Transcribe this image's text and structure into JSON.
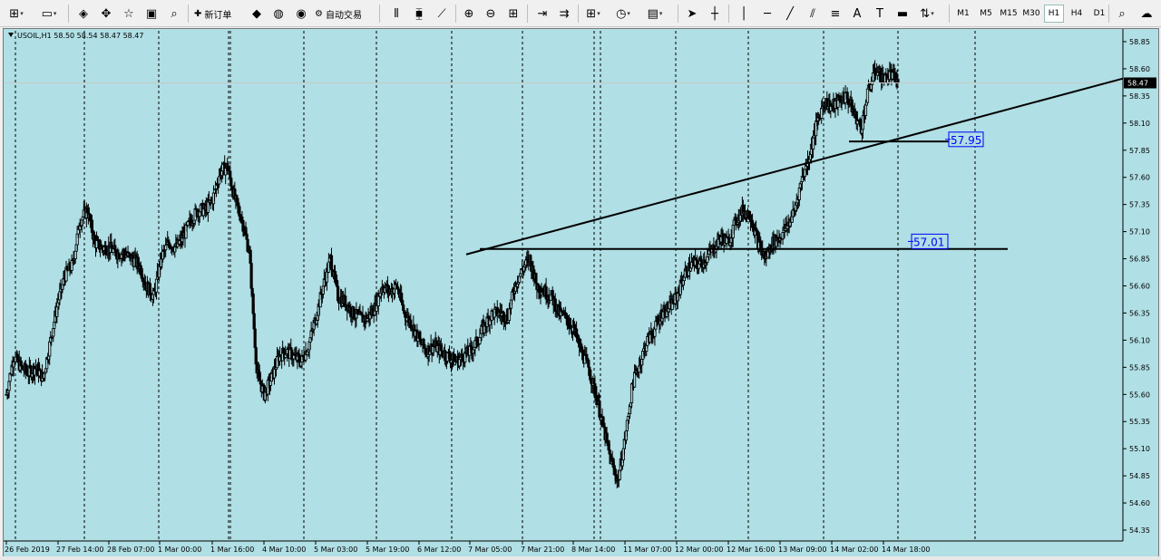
{
  "toolbar": {
    "new_order_label": "新订单",
    "auto_trading_label": "自动交易",
    "timeframes": [
      "M1",
      "M5",
      "M15",
      "M30",
      "H1",
      "H4",
      "D1"
    ],
    "active_timeframe": "H1"
  },
  "chart_data": {
    "type": "candlestick",
    "title": "USOIL,H1  58.50 58.54 58.47 58.47",
    "symbol_timeframe": "USOIL,H1",
    "ohlc": {
      "open": 58.5,
      "high": 58.54,
      "low": 58.47,
      "close": 58.47
    },
    "current_price": "58.47",
    "background_color": "#b0dfe5",
    "ylim": [
      54.25,
      58.95
    ],
    "y_ticks": [
      "58.85",
      "58.60",
      "58.35",
      "58.10",
      "57.85",
      "57.60",
      "57.35",
      "57.10",
      "56.85",
      "56.60",
      "56.35",
      "56.10",
      "55.85",
      "55.60",
      "55.35",
      "55.10",
      "54.85",
      "54.60",
      "54.35"
    ],
    "x_ticks": [
      "26 Feb 2019",
      "27 Feb 14:00",
      "28 Feb 07:00",
      "1 Mar 00:00",
      "1 Mar 16:00",
      "4 Mar 10:00",
      "5 Mar 03:00",
      "5 Mar 19:00",
      "6 Mar 12:00",
      "7 Mar 05:00",
      "7 Mar 21:00",
      "8 Mar 14:00",
      "11 Mar 07:00",
      "12 Mar 00:00",
      "12 Mar 16:00",
      "13 Mar 09:00",
      "14 Mar 02:00",
      "14 Mar 18:00"
    ],
    "grid": "vertical dashed at day separators",
    "closes": [
      55.6,
      55.95,
      55.85,
      55.8,
      55.85,
      55.75,
      56.1,
      56.45,
      56.7,
      56.8,
      57.2,
      57.3,
      57.0,
      56.95,
      56.95,
      56.9,
      56.9,
      56.85,
      56.8,
      56.6,
      56.5,
      56.85,
      57.0,
      56.95,
      57.05,
      57.2,
      57.3,
      57.3,
      57.4,
      57.65,
      57.7,
      57.4,
      57.2,
      56.9,
      55.8,
      55.6,
      55.75,
      55.95,
      56.0,
      55.95,
      55.9,
      56.05,
      56.3,
      56.6,
      56.85,
      56.5,
      56.45,
      56.35,
      56.3,
      56.3,
      56.4,
      56.6,
      56.55,
      56.6,
      56.35,
      56.25,
      56.1,
      56.0,
      56.05,
      56.0,
      55.95,
      55.9,
      55.95,
      56.0,
      56.1,
      56.25,
      56.35,
      56.35,
      56.3,
      56.6,
      56.75,
      56.85,
      56.6,
      56.55,
      56.5,
      56.35,
      56.3,
      56.2,
      56.0,
      55.85,
      55.6,
      55.3,
      55.0,
      54.8,
      55.2,
      55.7,
      55.9,
      56.1,
      56.2,
      56.35,
      56.4,
      56.5,
      56.7,
      56.8,
      56.8,
      56.85,
      56.95,
      57.05,
      57.0,
      57.2,
      57.3,
      57.25,
      57.0,
      56.85,
      57.0,
      57.05,
      57.15,
      57.3,
      57.6,
      57.8,
      58.1,
      58.3,
      58.25,
      58.3,
      58.35,
      58.2,
      58.05,
      58.4,
      58.6,
      58.5,
      58.55,
      58.47
    ]
  },
  "objects": {
    "horizontal_lines": [
      {
        "price": 57.95,
        "label": "57.95",
        "line_price": 57.93
      },
      {
        "price": 57.01,
        "label": "57.01",
        "line_price": 56.94
      }
    ],
    "trendline": {
      "from": {
        "time": "7 Mar 05:00",
        "price": 56.89
      },
      "to": {
        "time": "after 14 Mar 18:00",
        "price": 58.51
      }
    }
  }
}
